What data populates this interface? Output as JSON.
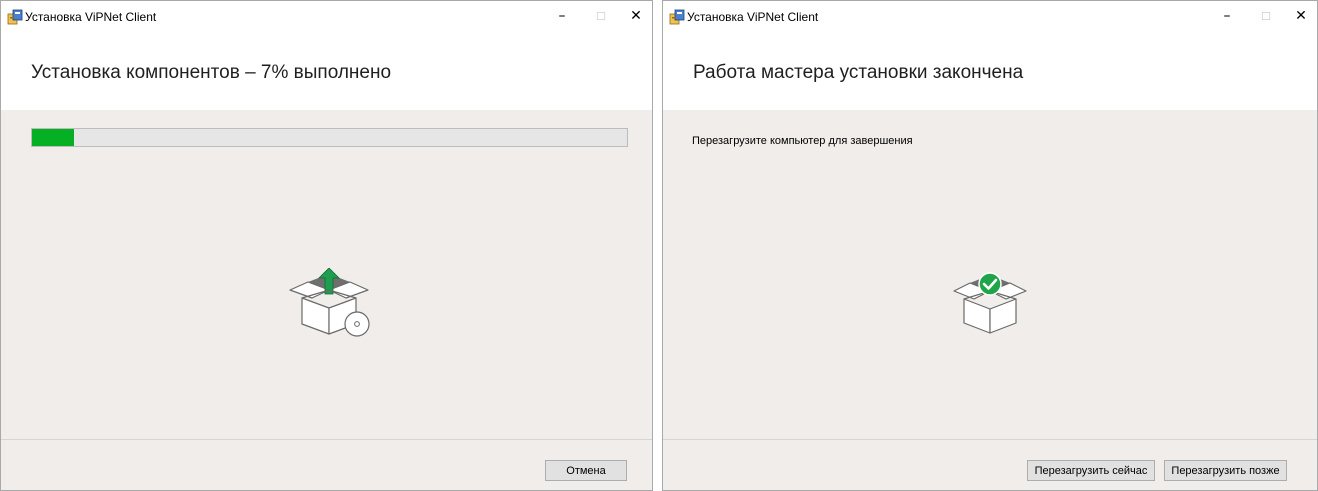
{
  "colors": {
    "progress_fill": "#06b025",
    "check_badge": "#1ea54a",
    "upload_arrow": "#1e9e4e"
  },
  "install_window": {
    "title": "Установка ViPNet Client",
    "controls": {
      "minimize": "–",
      "maximize": "☐",
      "close": "✕"
    },
    "heading": "Установка компонентов – 7% выполнено",
    "progress": 7,
    "cancel_label": "Отмена",
    "icon": "package-install-icon"
  },
  "done_window": {
    "title": "Установка ViPNet Client",
    "controls": {
      "minimize": "–",
      "maximize": "☐",
      "close": "✕"
    },
    "heading": "Работа мастера установки закончена",
    "message": "Перезагрузите компьютер для завершения",
    "restart_now_label": "Перезагрузить сейчас",
    "restart_later_label": "Перезагрузить позже",
    "icon": "package-complete-icon"
  }
}
